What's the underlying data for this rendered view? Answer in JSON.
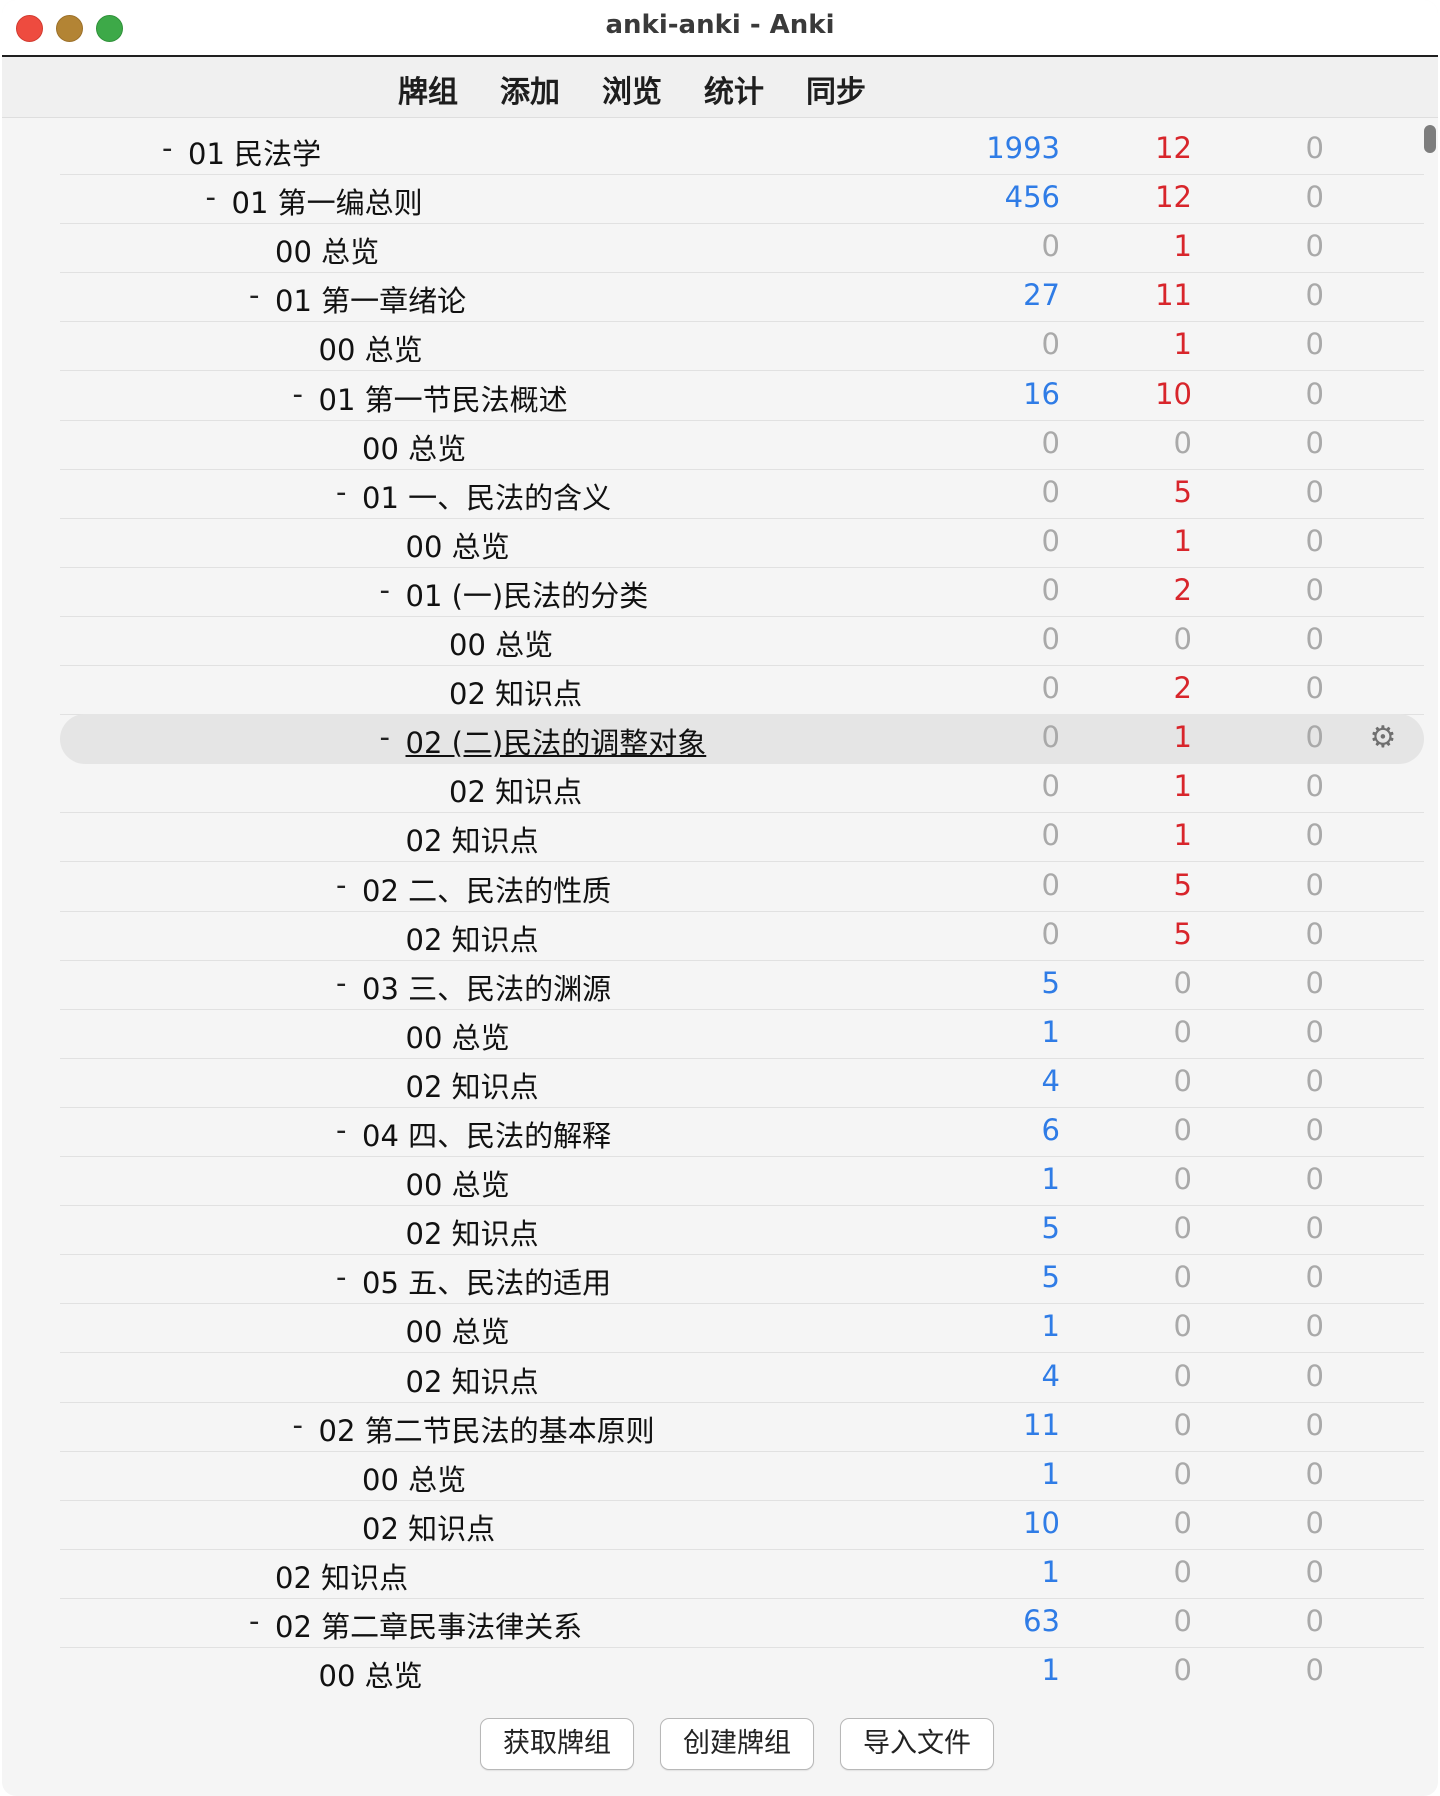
{
  "window": {
    "title": "anki-anki - Anki"
  },
  "toolbar": {
    "decks": "牌组",
    "add": "添加",
    "browse": "浏览",
    "stats": "统计",
    "sync": "同步"
  },
  "decks": [
    {
      "name": "01 民法学",
      "depth": 0,
      "collapsible": true,
      "new": "1993",
      "learn": "12",
      "due": "0"
    },
    {
      "name": "01 第一编总则",
      "depth": 1,
      "collapsible": true,
      "new": "456",
      "learn": "12",
      "due": "0"
    },
    {
      "name": "00 总览",
      "depth": 2,
      "collapsible": false,
      "new": "0",
      "learn": "1",
      "due": "0"
    },
    {
      "name": "01 第一章绪论",
      "depth": 2,
      "collapsible": true,
      "new": "27",
      "learn": "11",
      "due": "0"
    },
    {
      "name": "00 总览",
      "depth": 3,
      "collapsible": false,
      "new": "0",
      "learn": "1",
      "due": "0"
    },
    {
      "name": "01 第一节民法概述",
      "depth": 3,
      "collapsible": true,
      "new": "16",
      "learn": "10",
      "due": "0"
    },
    {
      "name": "00 总览",
      "depth": 4,
      "collapsible": false,
      "new": "0",
      "learn": "0",
      "due": "0"
    },
    {
      "name": "01 一、民法的含义",
      "depth": 4,
      "collapsible": true,
      "new": "0",
      "learn": "5",
      "due": "0"
    },
    {
      "name": "00 总览",
      "depth": 5,
      "collapsible": false,
      "new": "0",
      "learn": "1",
      "due": "0"
    },
    {
      "name": "01 (一)民法的分类",
      "depth": 5,
      "collapsible": true,
      "new": "0",
      "learn": "2",
      "due": "0"
    },
    {
      "name": "00 总览",
      "depth": 6,
      "collapsible": false,
      "new": "0",
      "learn": "0",
      "due": "0"
    },
    {
      "name": "02 知识点",
      "depth": 6,
      "collapsible": false,
      "new": "0",
      "learn": "2",
      "due": "0"
    },
    {
      "name": "02 (二)民法的调整对象",
      "depth": 5,
      "collapsible": true,
      "new": "0",
      "learn": "1",
      "due": "0",
      "current": true
    },
    {
      "name": "02 知识点",
      "depth": 6,
      "collapsible": false,
      "new": "0",
      "learn": "1",
      "due": "0"
    },
    {
      "name": "02 知识点",
      "depth": 5,
      "collapsible": false,
      "new": "0",
      "learn": "1",
      "due": "0"
    },
    {
      "name": "02 二、民法的性质",
      "depth": 4,
      "collapsible": true,
      "new": "0",
      "learn": "5",
      "due": "0"
    },
    {
      "name": "02 知识点",
      "depth": 5,
      "collapsible": false,
      "new": "0",
      "learn": "5",
      "due": "0"
    },
    {
      "name": "03 三、民法的渊源",
      "depth": 4,
      "collapsible": true,
      "new": "5",
      "learn": "0",
      "due": "0"
    },
    {
      "name": "00 总览",
      "depth": 5,
      "collapsible": false,
      "new": "1",
      "learn": "0",
      "due": "0"
    },
    {
      "name": "02 知识点",
      "depth": 5,
      "collapsible": false,
      "new": "4",
      "learn": "0",
      "due": "0"
    },
    {
      "name": "04 四、民法的解释",
      "depth": 4,
      "collapsible": true,
      "new": "6",
      "learn": "0",
      "due": "0"
    },
    {
      "name": "00 总览",
      "depth": 5,
      "collapsible": false,
      "new": "1",
      "learn": "0",
      "due": "0"
    },
    {
      "name": "02 知识点",
      "depth": 5,
      "collapsible": false,
      "new": "5",
      "learn": "0",
      "due": "0"
    },
    {
      "name": "05 五、民法的适用",
      "depth": 4,
      "collapsible": true,
      "new": "5",
      "learn": "0",
      "due": "0"
    },
    {
      "name": "00 总览",
      "depth": 5,
      "collapsible": false,
      "new": "1",
      "learn": "0",
      "due": "0"
    },
    {
      "name": "02 知识点",
      "depth": 5,
      "collapsible": false,
      "new": "4",
      "learn": "0",
      "due": "0"
    },
    {
      "name": "02 第二节民法的基本原则",
      "depth": 3,
      "collapsible": true,
      "new": "11",
      "learn": "0",
      "due": "0"
    },
    {
      "name": "00 总览",
      "depth": 4,
      "collapsible": false,
      "new": "1",
      "learn": "0",
      "due": "0"
    },
    {
      "name": "02 知识点",
      "depth": 4,
      "collapsible": false,
      "new": "10",
      "learn": "0",
      "due": "0"
    },
    {
      "name": "02 知识点",
      "depth": 2,
      "collapsible": false,
      "new": "1",
      "learn": "0",
      "due": "0"
    },
    {
      "name": "02 第二章民事法律关系",
      "depth": 2,
      "collapsible": true,
      "new": "63",
      "learn": "0",
      "due": "0"
    },
    {
      "name": "00 总览",
      "depth": 3,
      "collapsible": false,
      "new": "1",
      "learn": "0",
      "due": "0"
    }
  ],
  "collapse_glyph": "-",
  "gear_icon": "gear-icon",
  "colors": {
    "new": "#2f7ce6",
    "learn": "#d8252b",
    "zero": "#a9a9a9"
  },
  "bottom": {
    "get_shared": "获取牌组",
    "create_deck": "创建牌组",
    "import_file": "导入文件"
  }
}
